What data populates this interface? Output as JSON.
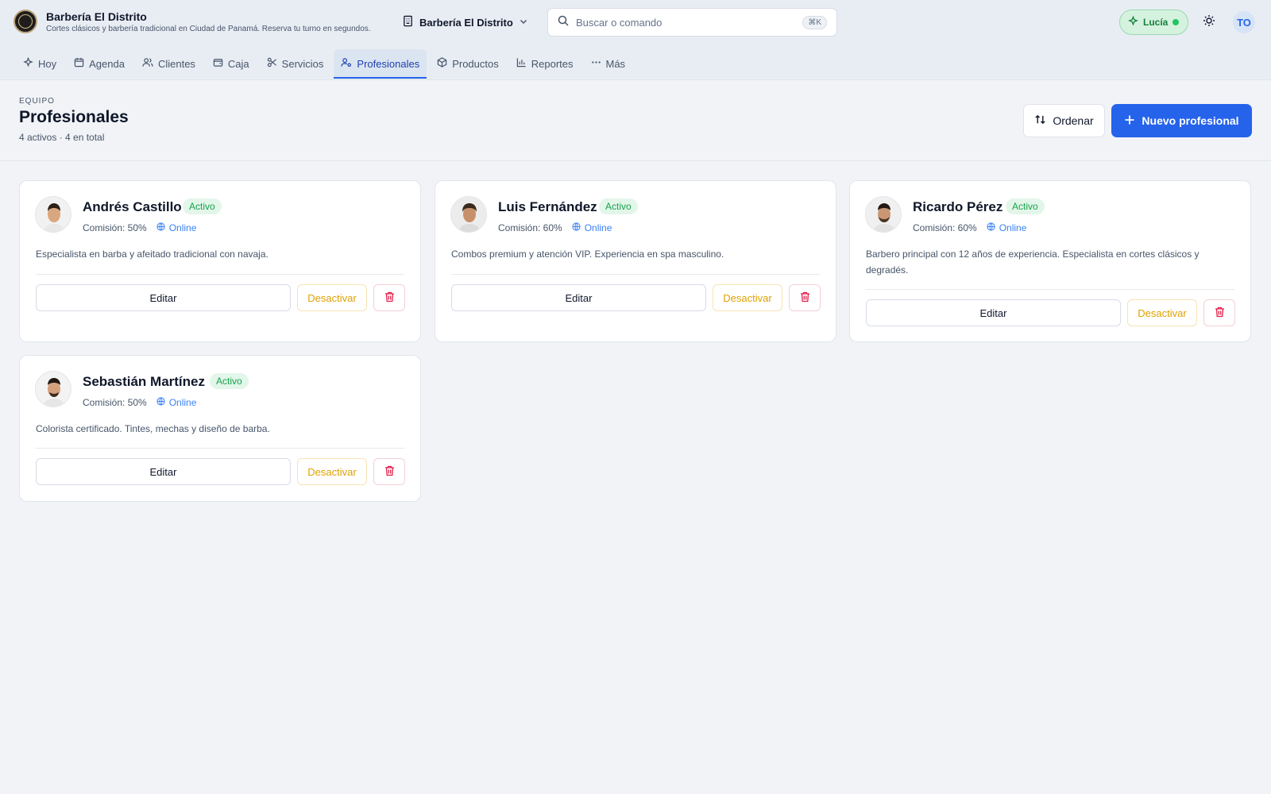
{
  "header": {
    "brand_title": "Barbería El Distrito",
    "brand_subtitle": "Cortes clásicos y barbería tradicional en Ciudad de Panamá. Reserva tu turno en segundos.",
    "business_selector": "Barbería El Distrito",
    "search_placeholder": "Buscar o comando",
    "search_shortcut": "⌘K",
    "user_name": "Lucía",
    "user_initials": "TO"
  },
  "nav": {
    "items": [
      {
        "label": "Hoy",
        "icon": "sparkle-icon"
      },
      {
        "label": "Agenda",
        "icon": "calendar-icon"
      },
      {
        "label": "Clientes",
        "icon": "users-icon"
      },
      {
        "label": "Caja",
        "icon": "wallet-icon"
      },
      {
        "label": "Servicios",
        "icon": "scissors-icon"
      },
      {
        "label": "Profesionales",
        "icon": "user-cog-icon",
        "active": true
      },
      {
        "label": "Productos",
        "icon": "package-icon"
      },
      {
        "label": "Reportes",
        "icon": "bar-chart-icon"
      },
      {
        "label": "Más",
        "icon": "more-icon"
      }
    ]
  },
  "page": {
    "eyebrow": "EQUIPO",
    "title": "Profesionales",
    "count": "4 activos · 4 en total",
    "order_label": "Ordenar",
    "new_label": "Nuevo profesional"
  },
  "professionals": [
    {
      "name": "Andrés Castillo",
      "status": "Activo",
      "commission": "Comisión: 50%",
      "channel": "Online",
      "description": "Especialista en barba y afeitado tradicional con navaja.",
      "edit": "Editar",
      "deactivate": "Desactivar"
    },
    {
      "name": "Luis Fernández",
      "status": "Activo",
      "commission": "Comisión: 60%",
      "channel": "Online",
      "description": "Combos premium y atención VIP. Experiencia en spa masculino.",
      "edit": "Editar",
      "deactivate": "Desactivar"
    },
    {
      "name": "Ricardo Pérez",
      "status": "Activo",
      "commission": "Comisión: 60%",
      "channel": "Online",
      "description": "Barbero principal con 12 años de experiencia. Especialista en cortes clásicos y degradés.",
      "edit": "Editar",
      "deactivate": "Desactivar"
    },
    {
      "name": "Sebastián Martínez",
      "status": "Activo",
      "commission": "Comisión: 50%",
      "channel": "Online",
      "description": "Colorista certificado. Tintes, mechas y diseño de barba.",
      "edit": "Editar",
      "deactivate": "Desactivar"
    }
  ],
  "colors": {
    "accent": "#2563eb",
    "active_badge": "#16a34a",
    "deactivate": "#e0a100",
    "delete": "#e11d48"
  }
}
